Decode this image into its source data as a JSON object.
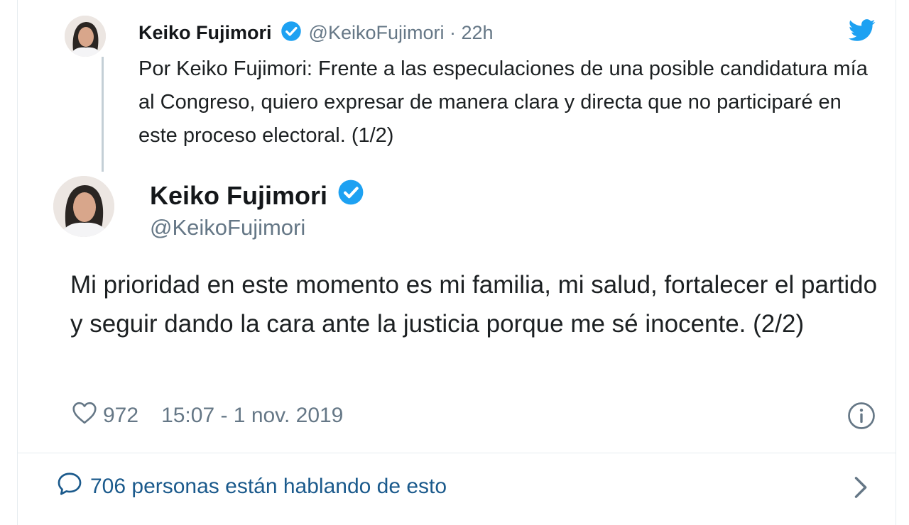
{
  "parent_tweet": {
    "name": "Keiko Fujimori",
    "handle": "@KeikoFujimori · 22h",
    "text": "Por Keiko Fujimori: Frente a las especulaciones de una posible candidatura mía al Congreso, quiero expresar de manera clara y directa que no participaré en este proceso electoral. (1/2)"
  },
  "main_tweet": {
    "name": "Keiko Fujimori",
    "handle": "@KeikoFujimori",
    "text": "Mi prioridad en este momento es mi familia, mi salud, fortalecer el partido y seguir dando la cara ante la justicia porque me sé inocente. (2/2)",
    "likes": "972",
    "timestamp": "15:07 - 1 nov. 2019"
  },
  "conversation": {
    "label": "706 personas están hablando de esto"
  },
  "colors": {
    "verified": "#1da1f2",
    "link": "#1b5a8c",
    "secondary": "#657786"
  },
  "icons": [
    "twitter-icon",
    "verified-icon",
    "heart-icon",
    "info-icon",
    "comment-icon",
    "chevron-right-icon"
  ]
}
